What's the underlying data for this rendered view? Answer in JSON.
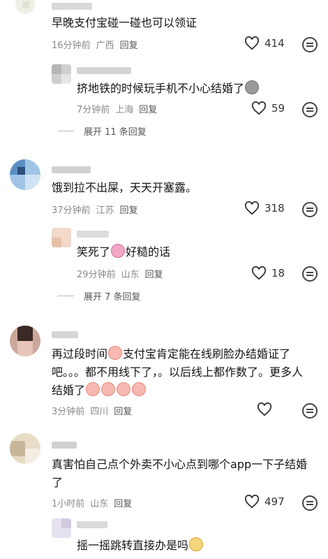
{
  "comments": [
    {
      "content": "早晚支付宝碰一碰也可以领证",
      "time": "16分钟前",
      "location": "广西",
      "reply_label": "回复",
      "likes": "414",
      "replies": [
        {
          "content": "挤地铁的时候玩手机不小心结婚了",
          "emoji": "sad-face-icon",
          "time": "7分钟前",
          "location": "上海",
          "reply_label": "回复",
          "likes": "59"
        }
      ],
      "expand_label": "展开 11 条回复"
    },
    {
      "content": "饿到拉不出屎，天天开塞露。",
      "time": "37分钟前",
      "location": "江苏",
      "reply_label": "回复",
      "likes": "318",
      "replies": [
        {
          "content_a": "笑死了",
          "content_b": "好糙的话",
          "emoji": "laugh-cry-icon",
          "time": "29分钟前",
          "location": "山东",
          "reply_label": "回复",
          "likes": "18"
        }
      ],
      "expand_label": "展开 7 条回复"
    },
    {
      "line1_a": "再过段时间",
      "line1_b": "支付宝肯定能在线刷脸办结婚证了",
      "line2": "吧。。。都不用线下了，。以后线上都作数了。更多人",
      "line3": "结婚了",
      "time": "3分钟前",
      "location": "四川",
      "reply_label": "回复",
      "likes": ""
    },
    {
      "line1": "真害怕自己点个外卖不小心点到哪个app一下子结婚",
      "line2": "了",
      "time": "1小时前",
      "location": "山东",
      "reply_label": "回复",
      "likes": "497",
      "replies": [
        {
          "content": "摇一摇跳转直接办是吗",
          "emoji": "pet-face-icon"
        }
      ]
    }
  ]
}
